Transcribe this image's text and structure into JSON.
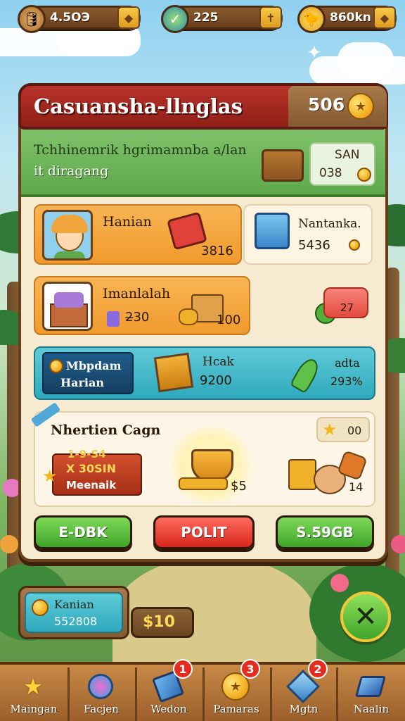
{
  "resources": [
    {
      "icon": "barrel-icon",
      "value": "4.5OЭ",
      "plus": "◆"
    },
    {
      "icon": "checkmark-globe-icon",
      "value": "225",
      "plus": "✝"
    },
    {
      "icon": "bird-icon",
      "value": "860kn",
      "plus": "◆"
    }
  ],
  "panel": {
    "title": "Casuansha-llnglas",
    "title_coins": "506",
    "banner_line1": "Tchhinemrik hgrimamnba a/lan",
    "banner_line2": "it diragang",
    "banner_box_line1": "SAN",
    "banner_box_line2": "038"
  },
  "cards": {
    "row1_left_label": "Hanian",
    "row1_left_value": "3816",
    "row1_right_label": "Nantanka.",
    "row1_right_value": "5436",
    "row2_left_label": "Imanlalah",
    "row2_left_value1": "2̶30",
    "row2_left_value2": "100",
    "row2_right_value": "27",
    "row3_tag_line1": "Mbpdam",
    "row3_tag_line2": "Harian",
    "row3_mid_label": "Hcak",
    "row3_mid_value": "9200",
    "row3_right_label": "adta",
    "row3_right_value": "293%"
  },
  "event": {
    "title": "Nhertien Cagn",
    "stars": "00",
    "tag_top": "1-9-S4",
    "tag_mid": "X 30SIN",
    "tag_bottom": "Meenaik",
    "trophy_value": "$5",
    "pet_value": "14"
  },
  "buttons": {
    "left": "E-DBK",
    "middle": "POLIT",
    "right": "S.59GB"
  },
  "bottom_widget": {
    "line1": "Kanian",
    "line2": "552808",
    "price": "$10"
  },
  "nav": [
    {
      "label": "Maingan",
      "icon": "star-icon",
      "badge": ""
    },
    {
      "label": "Facjen",
      "icon": "gem-icon",
      "badge": ""
    },
    {
      "label": "Wedon",
      "icon": "map-icon",
      "badge": "1"
    },
    {
      "label": "Pamaras",
      "icon": "coin-icon",
      "badge": "3"
    },
    {
      "label": "Mgtn",
      "icon": "crystal-icon",
      "badge": "2"
    },
    {
      "label": "Naalin",
      "icon": "blue-crystal-icon",
      "badge": ""
    }
  ],
  "colors": {
    "title_red": "#b8322a",
    "banner_green": "#7ec16a",
    "card_orange": "#f5a844",
    "card_teal": "#3fb4c6",
    "button_green": "#3fa52a",
    "button_red": "#d8251a"
  }
}
